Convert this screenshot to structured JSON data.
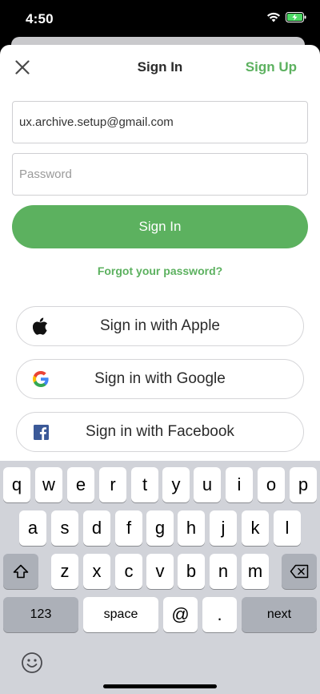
{
  "status": {
    "time": "4:50"
  },
  "nav": {
    "title": "Sign In",
    "sign_up": "Sign Up"
  },
  "form": {
    "email_value": "ux.archive.setup@gmail.com",
    "password_placeholder": "Password",
    "sign_in_label": "Sign In",
    "forgot_label": "Forgot your password?"
  },
  "social": {
    "apple": "Sign in with Apple",
    "google": "Sign in with Google",
    "facebook": "Sign in with Facebook"
  },
  "keyboard": {
    "row1": [
      "q",
      "w",
      "e",
      "r",
      "t",
      "y",
      "u",
      "i",
      "o",
      "p"
    ],
    "row2": [
      "a",
      "s",
      "d",
      "f",
      "g",
      "h",
      "j",
      "k",
      "l"
    ],
    "row3": [
      "z",
      "x",
      "c",
      "v",
      "b",
      "n",
      "m"
    ],
    "numbers": "123",
    "space": "space",
    "at": "@",
    "dot": ".",
    "next": "next"
  },
  "colors": {
    "accent": "#5cb15f",
    "facebook": "#3b5998"
  }
}
